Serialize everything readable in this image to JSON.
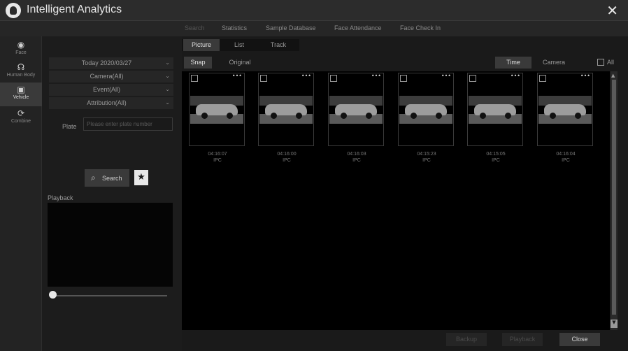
{
  "app": {
    "title": "Intelligent Analytics",
    "close_glyph": "✕"
  },
  "topnav": {
    "tabs": [
      {
        "label": "Search"
      },
      {
        "label": "Statistics"
      },
      {
        "label": "Sample Database"
      },
      {
        "label": "Face Attendance"
      },
      {
        "label": "Face Check In"
      }
    ]
  },
  "leftrail": {
    "items": [
      {
        "label": "Face",
        "icon": "face-icon",
        "glyph": "◉"
      },
      {
        "label": "Human Body",
        "icon": "human-body-icon",
        "glyph": "☊"
      },
      {
        "label": "Vehicle",
        "icon": "vehicle-icon",
        "glyph": "▣"
      },
      {
        "label": "Combine",
        "icon": "combine-icon",
        "glyph": "⟳"
      }
    ],
    "active": "Vehicle"
  },
  "filters": {
    "date": "Today 2020/03/27",
    "camera": "Camera(All)",
    "event": "Event(All)",
    "attribution": "Attribution(All)",
    "plate_label": "Plate",
    "plate_placeholder": "Please enter plate number",
    "search_label": "Search",
    "playback_label": "Playback"
  },
  "view": {
    "tabs": [
      {
        "label": "Picture"
      },
      {
        "label": "List"
      },
      {
        "label": "Track"
      }
    ],
    "active": "Picture",
    "image_mode": [
      {
        "label": "Snap"
      },
      {
        "label": "Original"
      }
    ],
    "image_mode_active": "Snap",
    "sort": [
      {
        "label": "Time"
      },
      {
        "label": "Camera"
      }
    ],
    "sort_active": "Time",
    "all_label": "All"
  },
  "results": [
    {
      "time": "04:16:07",
      "source": "IPC"
    },
    {
      "time": "04:16:00",
      "source": "IPC"
    },
    {
      "time": "04:16:03",
      "source": "IPC"
    },
    {
      "time": "04:15:23",
      "source": "IPC"
    },
    {
      "time": "04:15:05",
      "source": "IPC"
    },
    {
      "time": "04:16:04",
      "source": "IPC"
    }
  ],
  "bottom": {
    "backup": "Backup",
    "playback": "Playback",
    "close": "Close"
  },
  "colors": {
    "background": "#1a1a1a",
    "panel": "#262626",
    "active_tab": "#3a3a3a",
    "text": "#bdbdbd"
  }
}
